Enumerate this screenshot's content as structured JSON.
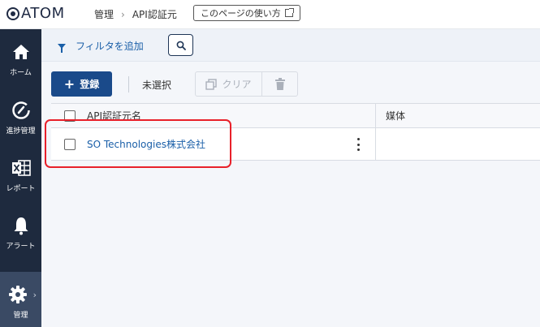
{
  "header": {
    "logo_text": "ATOM",
    "breadcrumb": [
      "管理",
      "API認証元"
    ],
    "help_button_label": "このページの使い方"
  },
  "sidebar": {
    "items": [
      {
        "label": "ホーム",
        "icon": "home-icon"
      },
      {
        "label": "進捗管理",
        "icon": "gauge-icon"
      },
      {
        "label": "レポート",
        "icon": "excel-icon"
      },
      {
        "label": "アラート",
        "icon": "bell-icon"
      },
      {
        "label": "管理",
        "icon": "gear-icon",
        "active": true
      }
    ]
  },
  "filter": {
    "add_filter_label": "フィルタを追加"
  },
  "toolbar": {
    "register_label": "登録",
    "selection_status": "未選択",
    "clear_label": "クリア"
  },
  "table": {
    "columns": [
      "API認証元名",
      "媒体"
    ],
    "rows": [
      {
        "name": "SO Technologies株式会社",
        "media": ""
      }
    ]
  },
  "colors": {
    "sidebar_bg": "#1e2a3e",
    "primary": "#1a4a8a",
    "link": "#1a5fa8",
    "highlight": "#e8202a"
  }
}
